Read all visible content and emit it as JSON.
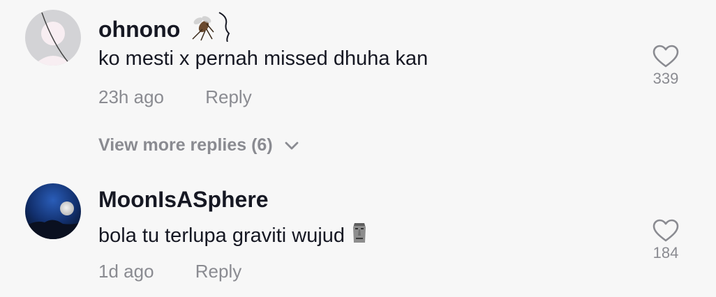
{
  "comments": [
    {
      "username": "ohnono",
      "username_emoji": "mosquito-and-curve",
      "text": "ko mesti x pernah missed dhuha kan",
      "time": "23h ago",
      "reply_label": "Reply",
      "likes": "339"
    },
    {
      "username": "MoonIsASphere",
      "text": "bola tu terlupa graviti wujud",
      "text_emoji": "moai",
      "time": "1d ago",
      "reply_label": "Reply",
      "likes": "184"
    }
  ],
  "view_more_replies": "View more replies (6)",
  "icons": {
    "like": "heart-outline-icon",
    "expand": "chevron-down-icon"
  },
  "colors": {
    "background": "#f7f7f7",
    "primary_text": "#161823",
    "secondary_text": "#8a8b91"
  }
}
